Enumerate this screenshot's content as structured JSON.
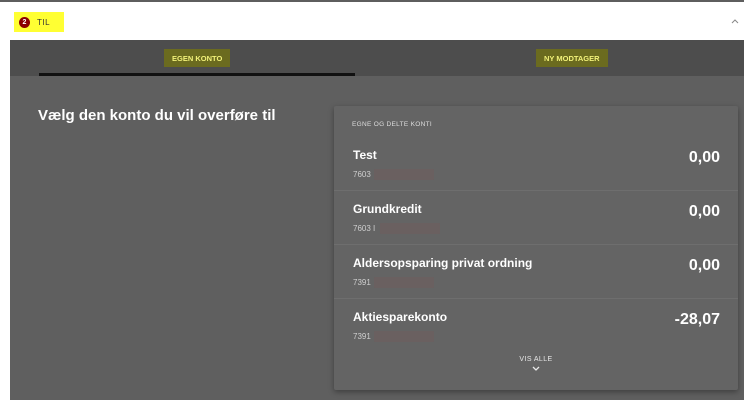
{
  "step": {
    "number": "2",
    "label": "TIL"
  },
  "tabs": {
    "own_account": "EGEN KONTO",
    "new_recipient": "NY MODTAGER"
  },
  "heading": "Vælg den konto du vil overføre til",
  "panel": {
    "header": "EGNE OG DELTE KONTI",
    "accounts": [
      {
        "name": "Test",
        "number": "7603",
        "balance": "0,00"
      },
      {
        "name": "Grundkredit",
        "number": "7603 I",
        "balance": "0,00"
      },
      {
        "name": "Aldersopsparing privat ordning",
        "number": "7391",
        "balance": "0,00"
      },
      {
        "name": "Aktiesparekonto",
        "number": "7391",
        "balance": "-28,07"
      }
    ],
    "show_all": "VIS ALLE"
  },
  "colors": {
    "accent_yellow": "#ffff33",
    "tab_bg": "#6b6b1f",
    "panel_bg": "#646464"
  },
  "icons": {
    "collapse": "chevron-up-icon",
    "expand": "chevron-down-icon"
  }
}
